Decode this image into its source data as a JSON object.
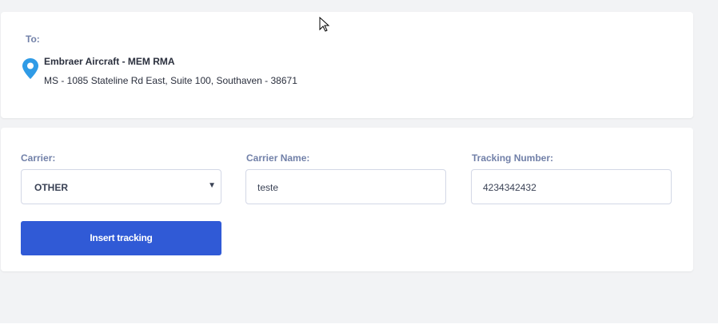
{
  "destination": {
    "label": "To:",
    "name": "Embraer Aircraft - MEM RMA",
    "address": "MS - 1085 Stateline Rd East, Suite 100, Southaven - 38671",
    "icon": "map-pin-icon",
    "icon_color": "#2f9be6"
  },
  "form": {
    "carrier": {
      "label": "Carrier:",
      "value": "OTHER"
    },
    "carrier_name": {
      "label": "Carrier Name:",
      "value": "teste"
    },
    "tracking_number": {
      "label": "Tracking Number:",
      "value": "4234342432"
    },
    "submit_label": "Insert tracking",
    "accent": "#305ad6"
  }
}
